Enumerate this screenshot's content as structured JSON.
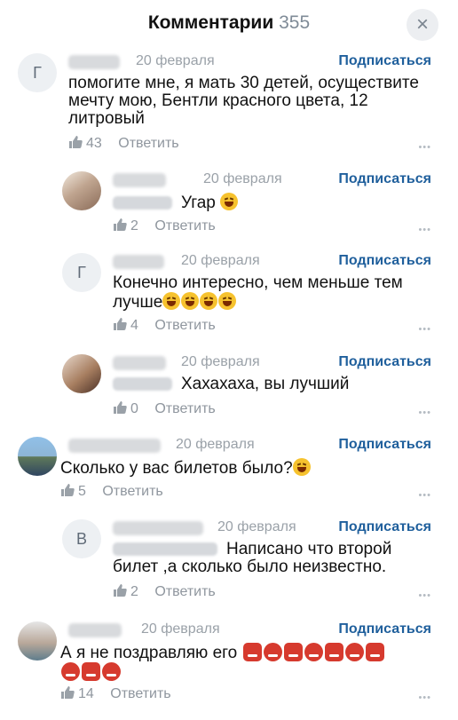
{
  "header": {
    "title": "Комментарии",
    "count": "355",
    "close_icon": "×"
  },
  "comments": [
    {
      "avatar": "Г",
      "date": "20 февраля",
      "subscribe": "Подписаться",
      "text": "помогите мне, я мать 30 детей, осуществите мечту мою, Бентли красного цвета, 12 литровый",
      "likes": "43",
      "reply": "Ответить"
    },
    {
      "avatar": "",
      "date": "20 февраля",
      "subscribe": "Подписаться",
      "text": "Угар",
      "likes": "2",
      "reply": "Ответить"
    },
    {
      "avatar": "Г",
      "date": "20 февраля",
      "subscribe": "Подписаться",
      "text": "Конечно интересно, чем меньше тем лучше",
      "likes": "4",
      "reply": "Ответить"
    },
    {
      "avatar": "",
      "date": "20 февраля",
      "subscribe": "Подписаться",
      "text": "Хахахаха, вы лучший",
      "likes": "0",
      "reply": "Ответить"
    },
    {
      "avatar": "",
      "date": "20 февраля",
      "subscribe": "Подписаться",
      "text": "Сколько у вас билетов было?",
      "likes": "5",
      "reply": "Ответить"
    },
    {
      "avatar": "В",
      "date": "20 февраля",
      "subscribe": "Подписаться",
      "text": "Написано что второй билет ,а сколько было неизвестно.",
      "likes": "2",
      "reply": "Ответить"
    },
    {
      "avatar": "",
      "date": "20 февраля",
      "subscribe": "Подписаться",
      "text": "А я не поздравляю его",
      "likes": "14",
      "reply": "Ответить"
    }
  ],
  "colors": {
    "accent": "#1f5f9c",
    "muted": "#9aa1a8"
  }
}
